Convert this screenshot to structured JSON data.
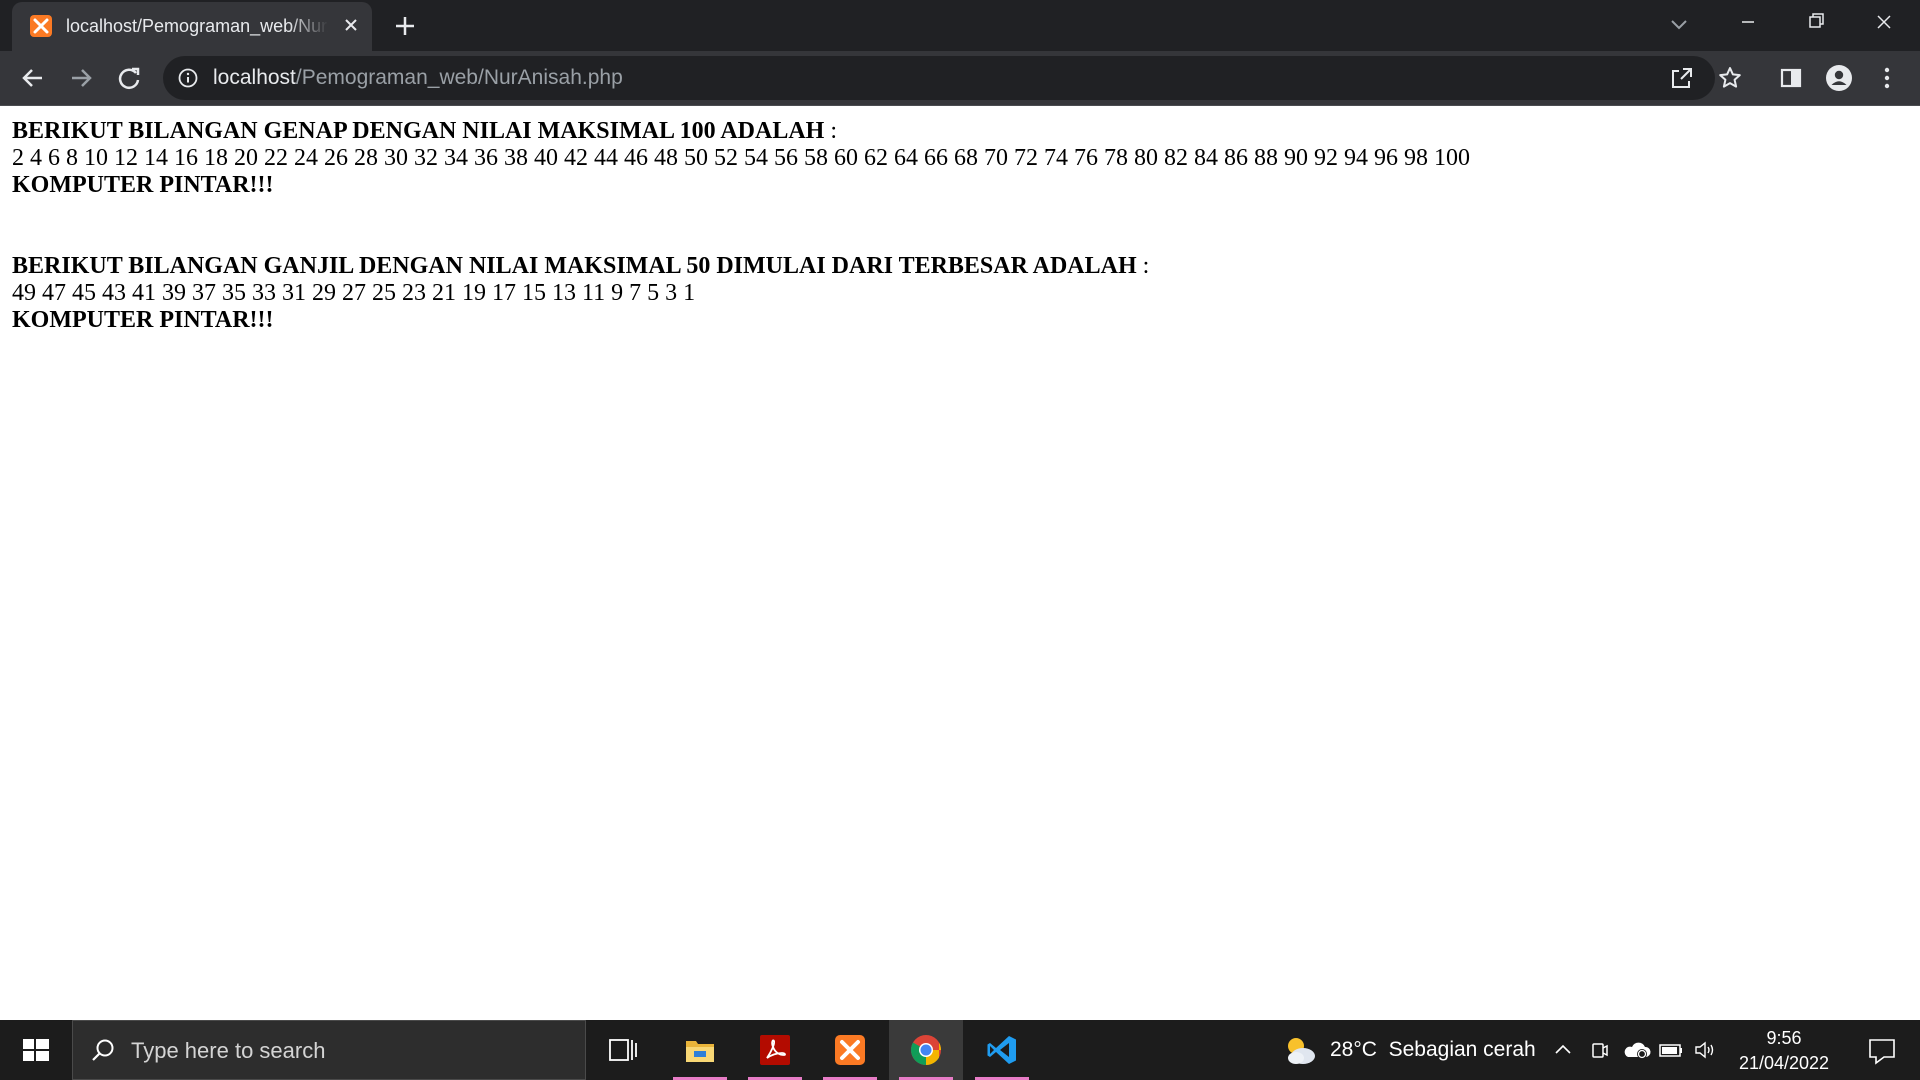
{
  "browser": {
    "tab": {
      "title": "localhost/Pemograman_web/NurAnisah.php"
    },
    "address_bar": {
      "host": "localhost",
      "path": "/Pemograman_web/NurAnisah.php"
    }
  },
  "page": {
    "block1": {
      "heading": "BERIKUT BILANGAN GENAP DENGAN NILAI MAKSIMAL 100 ADALAH",
      "colon": " :",
      "numbers": "2 4 6 8 10 12 14 16 18 20 22 24 26 28 30 32 34 36 38 40 42 44 46 48 50 52 54 56 58 60 62 64 66 68 70 72 74 76 78 80 82 84 86 88 90 92 94 96 98 100",
      "footer": "KOMPUTER PINTAR!!!"
    },
    "block2": {
      "heading": "BERIKUT BILANGAN GANJIL DENGAN NILAI MAKSIMAL 50 DIMULAI DARI TERBESAR ADALAH",
      "colon": " :",
      "numbers": "49 47 45 43 41 39 37 35 33 31 29 27 25 23 21 19 17 15 13 11 9 7 5 3 1",
      "footer": "KOMPUTER PINTAR!!!"
    }
  },
  "taskbar": {
    "search_placeholder": "Type here to search",
    "apps": [
      "task-view",
      "file-explorer",
      "acrobat",
      "xampp",
      "chrome",
      "vscode"
    ],
    "weather": {
      "temperature": "28°C",
      "condition": "Sebagian cerah"
    },
    "clock": {
      "time": "9:56",
      "date": "21/04/2022"
    }
  },
  "colors": {
    "titlebar": "#202124",
    "toolbar": "#35363a",
    "xampp_orange": "#fb7a24",
    "taskbar": "#1c1c1c"
  }
}
